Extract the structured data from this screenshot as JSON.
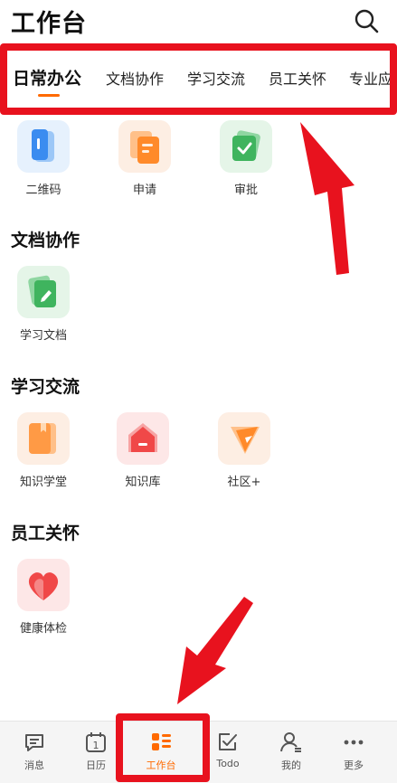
{
  "header": {
    "title": "工作台",
    "search_icon": "search-icon"
  },
  "tabs": [
    {
      "label": "日常办公",
      "active": true
    },
    {
      "label": "文档协作",
      "active": false
    },
    {
      "label": "学习交流",
      "active": false
    },
    {
      "label": "员工关怀",
      "active": false
    },
    {
      "label": "专业应",
      "active": false
    }
  ],
  "sections": {
    "office": {
      "apps": [
        {
          "label": "二维码",
          "icon": "qrcode-icon",
          "color": "#3b8cf0"
        },
        {
          "label": "申请",
          "icon": "apply-icon",
          "color": "#ff8a2a"
        },
        {
          "label": "审批",
          "icon": "approve-icon",
          "color": "#3fb45e"
        }
      ]
    },
    "docs": {
      "title": "文档协作",
      "apps": [
        {
          "label": "学习文档",
          "icon": "document-icon",
          "color": "#3fb45e"
        }
      ]
    },
    "learning": {
      "title": "学习交流",
      "apps": [
        {
          "label": "知识学堂",
          "icon": "book-icon",
          "color": "#ff8a2a"
        },
        {
          "label": "知识库",
          "icon": "knowledge-icon",
          "color": "#f04848"
        },
        {
          "label": "社区+",
          "icon": "community-icon",
          "color": "#ff8a2a"
        }
      ]
    },
    "care": {
      "title": "员工关怀",
      "apps": [
        {
          "label": "健康体检",
          "icon": "heart-icon",
          "color": "#f04848"
        }
      ]
    }
  },
  "bottom_nav": [
    {
      "label": "消息",
      "icon": "message-icon",
      "active": false
    },
    {
      "label": "日历",
      "icon": "calendar-icon",
      "badge": "1",
      "active": false
    },
    {
      "label": "工作台",
      "icon": "workbench-icon",
      "active": true
    },
    {
      "label": "Todo",
      "icon": "todo-icon",
      "active": false
    },
    {
      "label": "我的",
      "icon": "profile-icon",
      "active": false
    },
    {
      "label": "更多",
      "icon": "more-icon",
      "active": false
    }
  ],
  "colors": {
    "accent": "#ff6a00",
    "annotation_red": "#e8121e"
  }
}
